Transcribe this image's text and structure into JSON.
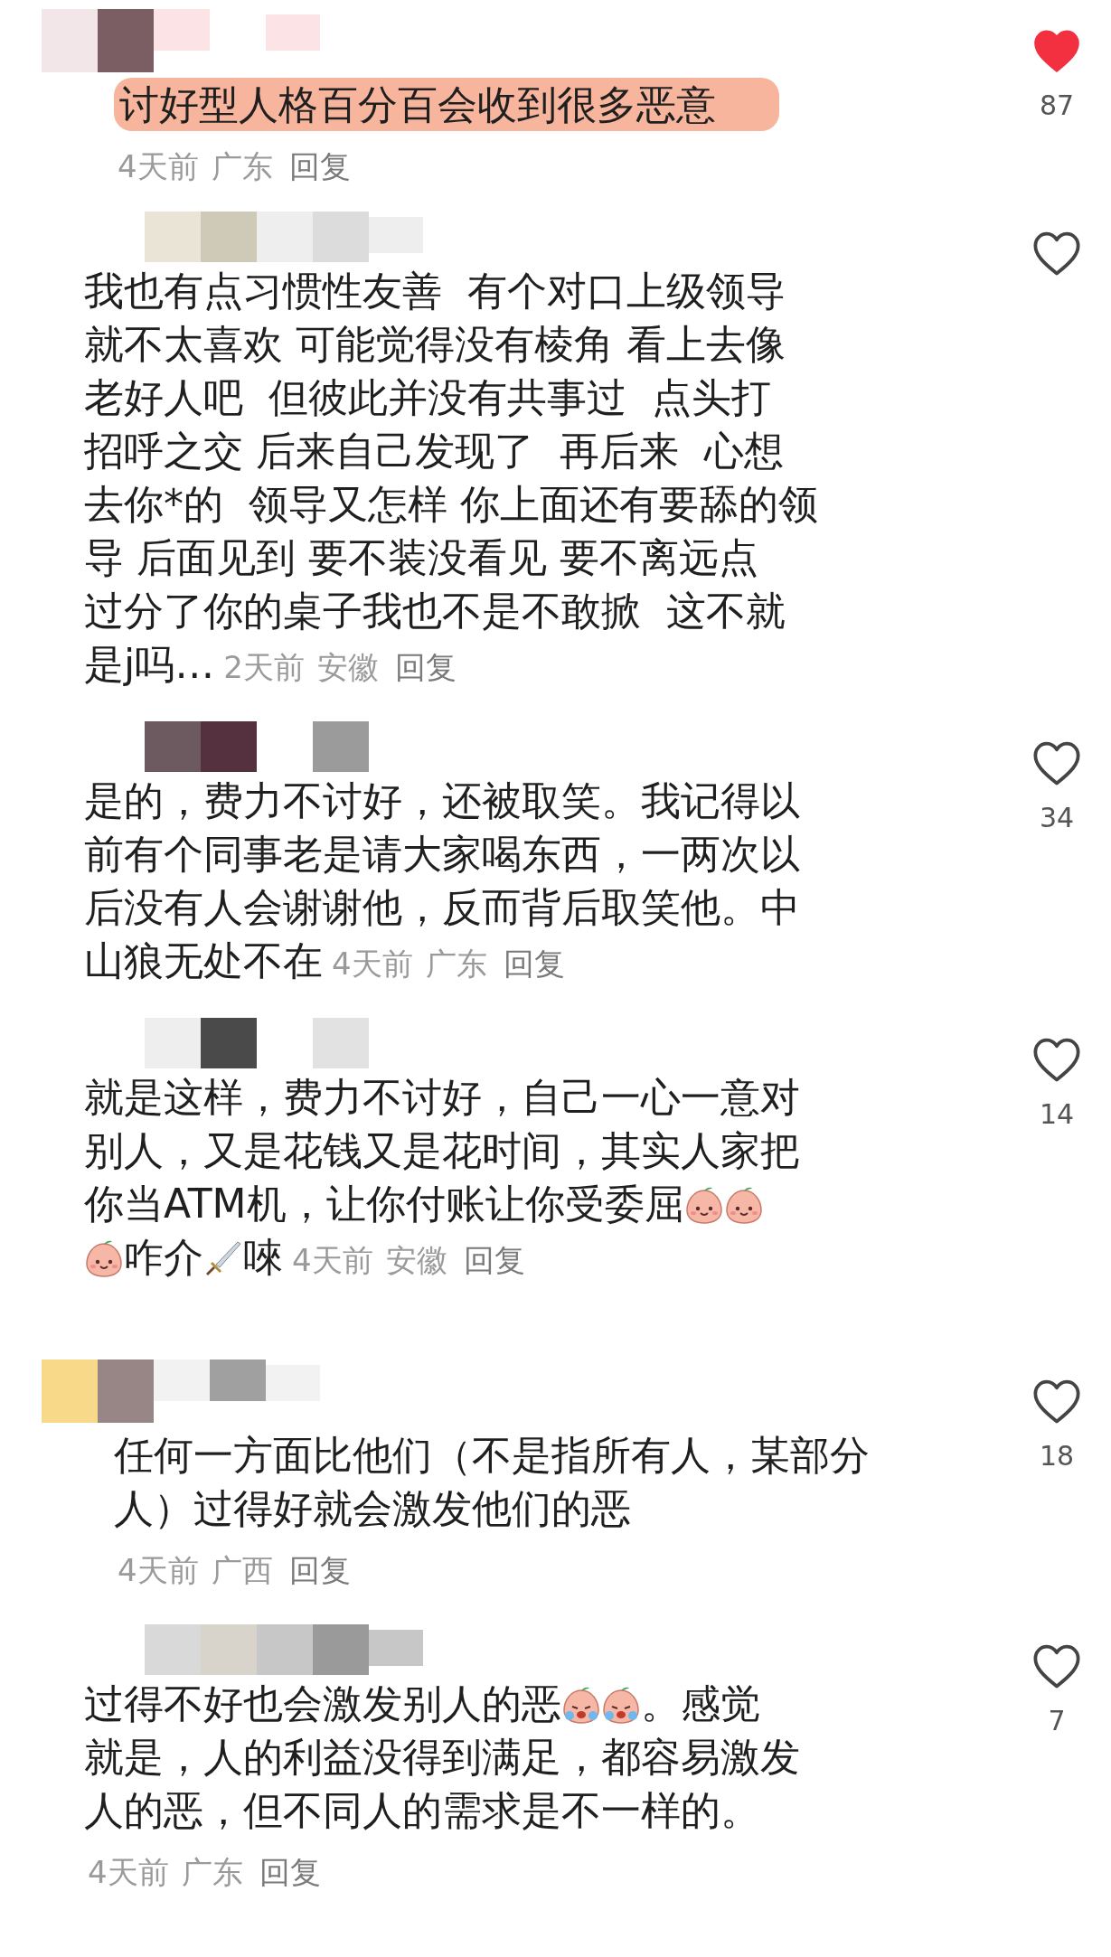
{
  "comments": [
    {
      "kind": "comment",
      "liked": true,
      "likes": "87",
      "highlighted": true,
      "lines": [
        [
          {
            "kind": "text",
            "text": "讨好型人格百分百会收到很多恶意"
          }
        ],
        [
          {
            "kind": "meta",
            "time": "4天前",
            "location": "广东",
            "reply": "回复"
          }
        ]
      ]
    },
    {
      "kind": "reply",
      "liked": false,
      "highlighted": false,
      "lines": [
        [
          {
            "kind": "text",
            "text": "我也有点习惯性友善  有个对口上级领导"
          }
        ],
        [
          {
            "kind": "text",
            "text": "就不太喜欢 可能觉得没有棱角 看上去像"
          }
        ],
        [
          {
            "kind": "text",
            "text": "老好人吧  但彼此并没有共事过  点头打"
          }
        ],
        [
          {
            "kind": "text",
            "text": "招呼之交 后来自己发现了  再后来  心想"
          }
        ],
        [
          {
            "kind": "text",
            "text": "去你*的  领导又怎样 你上面还有要舔的领"
          }
        ],
        [
          {
            "kind": "text",
            "text": "导 后面见到 要不装没看见 要不离远点"
          }
        ],
        [
          {
            "kind": "text",
            "text": "过分了你的桌子我也不是不敢掀  这不就"
          }
        ],
        [
          {
            "kind": "text",
            "text": "是j吗…"
          },
          {
            "kind": "meta",
            "time": "2天前",
            "location": "安徽",
            "reply": "回复"
          }
        ]
      ]
    },
    {
      "kind": "reply",
      "liked": false,
      "likes": "34",
      "highlighted": false,
      "lines": [
        [
          {
            "kind": "text",
            "text": "是的，费力不讨好，还被取笑。我记得以"
          }
        ],
        [
          {
            "kind": "text",
            "text": "前有个同事老是请大家喝东西，一两次以"
          }
        ],
        [
          {
            "kind": "text",
            "text": "后没有人会谢谢他，反而背后取笑他。中"
          }
        ],
        [
          {
            "kind": "text",
            "text": "山狼无处不在"
          },
          {
            "kind": "meta",
            "time": "4天前",
            "location": "广东",
            "reply": "回复"
          }
        ]
      ]
    },
    {
      "kind": "reply",
      "liked": false,
      "likes": "14",
      "highlighted": false,
      "lines": [
        [
          {
            "kind": "text",
            "text": "就是这样，费力不讨好，自己一心一意对"
          }
        ],
        [
          {
            "kind": "text",
            "text": "别人，又是花钱又是花时间，其实人家把"
          }
        ],
        [
          {
            "kind": "text",
            "text": "你当ATM机，让你付账让你受委屈"
          },
          {
            "kind": "smile"
          },
          {
            "kind": "smile"
          }
        ],
        [
          {
            "kind": "smile"
          },
          {
            "kind": "text",
            "text": "咋介"
          },
          {
            "kind": "sword"
          },
          {
            "kind": "text",
            "text": "唻"
          },
          {
            "kind": "meta",
            "time": "4天前",
            "location": "安徽",
            "reply": "回复"
          }
        ]
      ]
    },
    {
      "kind": "comment",
      "liked": false,
      "likes": "18",
      "highlighted": false,
      "lines": [
        [
          {
            "kind": "text",
            "text": "任何一方面比他们（不是指所有人，某部分"
          }
        ],
        [
          {
            "kind": "text",
            "text": "人）过得好就会激发他们的恶"
          }
        ],
        [
          {
            "kind": "meta",
            "time": "4天前",
            "location": "广西",
            "reply": "回复"
          }
        ]
      ]
    },
    {
      "kind": "reply",
      "liked": false,
      "likes": "7",
      "highlighted": false,
      "lines": [
        [
          {
            "kind": "text",
            "text": "过得不好也会激发别人的恶"
          },
          {
            "kind": "cry"
          },
          {
            "kind": "cry"
          },
          {
            "kind": "text",
            "text": "。感觉"
          }
        ],
        [
          {
            "kind": "text",
            "text": "就是，人的利益没得到满足，都容易激发"
          }
        ],
        [
          {
            "kind": "text",
            "text": "人的恶，但不同人的需求是不一样的。"
          }
        ],
        [
          {
            "kind": "meta",
            "time": "4天前",
            "location": "广东",
            "reply": "回复"
          }
        ]
      ]
    }
  ]
}
